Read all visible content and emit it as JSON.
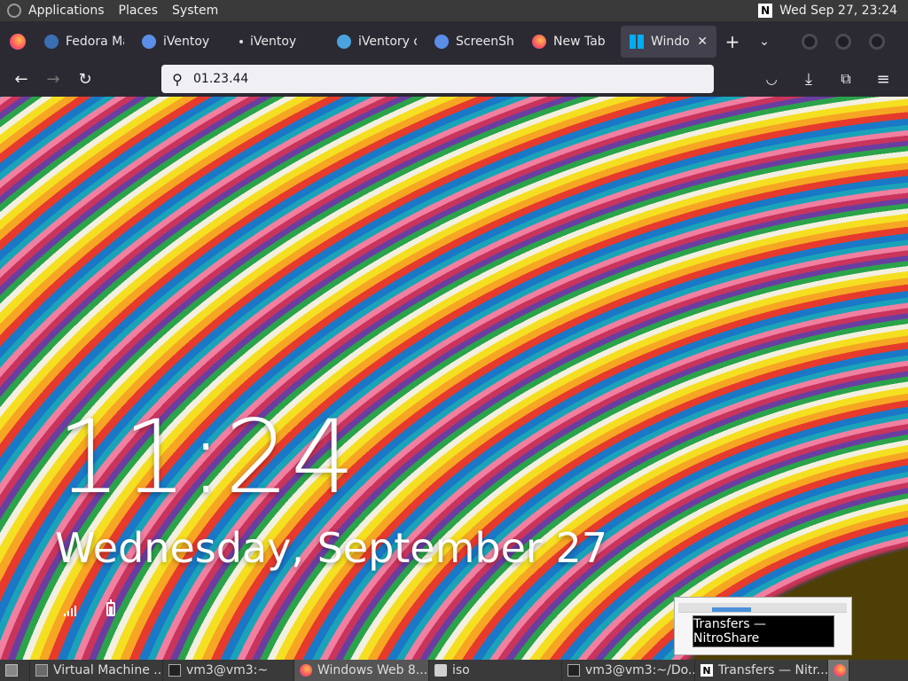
{
  "panel": {
    "menus": [
      "Applications",
      "Places",
      "System"
    ],
    "datetime": "Wed Sep 27, 23:24"
  },
  "tabs": [
    {
      "label": "Fedora Ma",
      "icon": "fedora-icon"
    },
    {
      "label": "iVentoy",
      "icon": "iventoy-icon"
    },
    {
      "label": "iVentoy",
      "icon": "dot-icon"
    },
    {
      "label": "iVentory ot",
      "icon": "iventoy-icon"
    },
    {
      "label": "ScreenShot",
      "icon": "iventoy-icon"
    },
    {
      "label": "New Tab",
      "icon": "firefox-icon"
    },
    {
      "label": "Windows",
      "icon": "windows-icon"
    }
  ],
  "url": {
    "value": "01.23.44"
  },
  "lockscreen": {
    "time": "11:24",
    "date": "Wednesday, September 27"
  },
  "tooltip": "Transfers — NitroShare",
  "taskbar": [
    {
      "label": "Virtual Machine ...",
      "icon": "vm-icon",
      "active": false
    },
    {
      "label": "vm3@vm3:~",
      "icon": "terminal-icon",
      "active": false
    },
    {
      "label": "Windows Web 8....",
      "icon": "firefox-icon",
      "active": true
    },
    {
      "label": "iso",
      "icon": "folder-icon",
      "active": false
    },
    {
      "label": "vm3@vm3:~/Do...",
      "icon": "terminal-icon",
      "active": false
    },
    {
      "label": "Transfers — Nitr...",
      "icon": "nitroshare-icon",
      "active": false
    }
  ]
}
